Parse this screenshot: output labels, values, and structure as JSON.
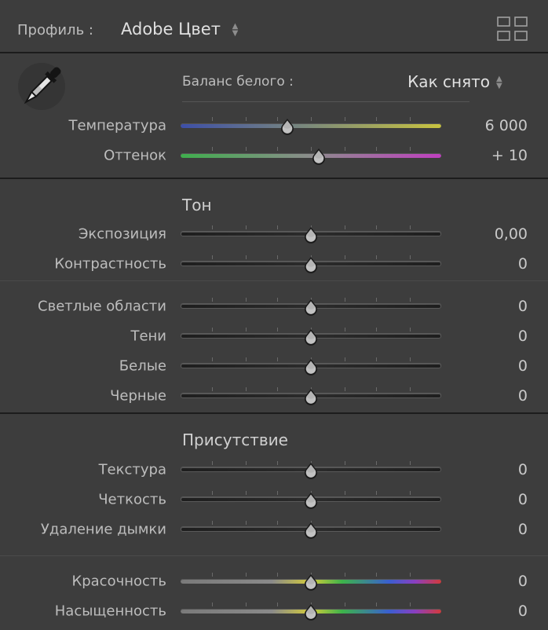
{
  "header": {
    "profile_label": "Профиль :",
    "profile_value": "Adobe Цвет"
  },
  "white_balance": {
    "label": "Баланс белого :",
    "value": "Как снято",
    "sliders": [
      {
        "label": "Температура",
        "value": "6 000",
        "position": 0.41
      },
      {
        "label": "Оттенок",
        "value": "+ 10",
        "position": 0.53
      }
    ]
  },
  "tone": {
    "title": "Тон",
    "sliders": [
      {
        "label": "Экспозиция",
        "value": "0,00",
        "position": 0.5
      },
      {
        "label": "Контрастность",
        "value": "0",
        "position": 0.5
      }
    ],
    "sliders2": [
      {
        "label": "Светлые области",
        "value": "0",
        "position": 0.5
      },
      {
        "label": "Тени",
        "value": "0",
        "position": 0.5
      },
      {
        "label": "Белые",
        "value": "0",
        "position": 0.5
      },
      {
        "label": "Черные",
        "value": "0",
        "position": 0.5
      }
    ]
  },
  "presence": {
    "title": "Присутствие",
    "sliders": [
      {
        "label": "Текстура",
        "value": "0",
        "position": 0.5
      },
      {
        "label": "Четкость",
        "value": "0",
        "position": 0.5
      },
      {
        "label": "Удаление дымки",
        "value": "0",
        "position": 0.5
      }
    ],
    "sliders2": [
      {
        "label": "Красочность",
        "value": "0",
        "position": 0.5
      },
      {
        "label": "Насыщенность",
        "value": "0",
        "position": 0.5
      }
    ]
  }
}
